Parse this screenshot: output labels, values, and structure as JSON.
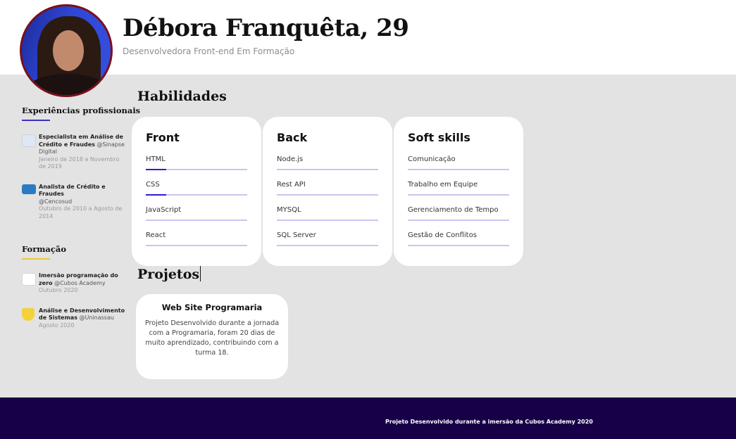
{
  "header": {
    "name": "Débora Franquêta, 29",
    "subtitle": "Desenvolvedora Front-end Em Formação"
  },
  "sidebar": {
    "experience_title": "Experiências profissionais",
    "experiences": [
      {
        "role": "Especialista em Análise de Crédito e Fraudes",
        "company": "@Sinapse Digital",
        "period": "Janeiro de 2018 a Novembro de 2019",
        "logo_color": "#dfe8f2"
      },
      {
        "role": "Analista de Crédito e Fraudes",
        "company": "@Cencosud",
        "period": "Outubro de 2010 a Agosto de 2014",
        "logo_color": "#2a7bc4"
      }
    ],
    "education_title": "Formação",
    "education": [
      {
        "role": "Imersão programação do zero",
        "company": "@Cubos Academy",
        "period": "Outubro 2020",
        "logo_color": "#ffffff"
      },
      {
        "role": "Análise e Desenvolvimento de Sistemas",
        "company": "@Uninassau",
        "period": "Agosto 2020",
        "logo_color": "#f4d23a"
      }
    ]
  },
  "skills": {
    "title": "Habilidades",
    "groups": [
      {
        "title": "Front",
        "items": [
          {
            "label": "HTML",
            "level": 0.2
          },
          {
            "label": "CSS",
            "level": 0.2
          },
          {
            "label": "JavaScript",
            "level": 0
          },
          {
            "label": "React",
            "level": 0
          }
        ]
      },
      {
        "title": "Back",
        "items": [
          {
            "label": "Node.js",
            "level": 0
          },
          {
            "label": "Rest API",
            "level": 0
          },
          {
            "label": "MYSQL",
            "level": 0
          },
          {
            "label": "SQL Server",
            "level": 0
          }
        ]
      },
      {
        "title": "Soft skills",
        "items": [
          {
            "label": "Comunicação",
            "level": 0
          },
          {
            "label": "Trabalho em Equipe",
            "level": 0
          },
          {
            "label": "Gerenciamento de Tempo",
            "level": 0
          },
          {
            "label": "Gestão de Conflitos",
            "level": 0
          }
        ]
      }
    ]
  },
  "projects": {
    "title": "Projetos",
    "items": [
      {
        "title": "Web Site Programaria",
        "description": "Projeto Desenvolvido durante a jornada com a Programaria, foram 20 dias de muito aprendizado, contribuindo com a turma 18."
      }
    ]
  },
  "footer": {
    "text": "Projeto Desenvolvido durante a imersão da Cubos Academy 2020"
  },
  "colors": {
    "header_bg": "#ffffff",
    "main_bg": "#e3e3e3",
    "footer_bg": "#180048",
    "accent": "#2f1bd6",
    "avatar_border": "#7a0f1c"
  }
}
